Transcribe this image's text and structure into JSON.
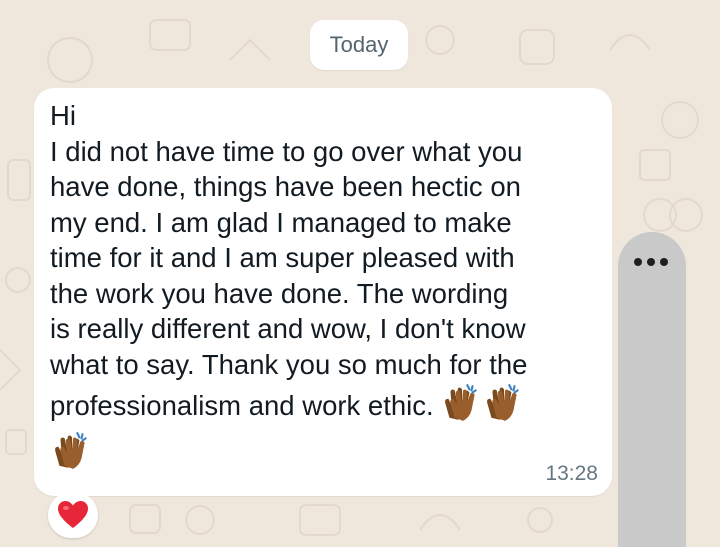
{
  "chat": {
    "date_separator": "Today",
    "message": {
      "text": "Hi\nI did not have time to go over what you\nhave done, things have been hectic on\nmy end. I am glad I managed to make\ntime for it and I am super pleased with\nthe work you have done. The wording\nis really different and wow, I don't know\nwhat to say. Thank you so much for the\nprofessionalism and work ethic.",
      "inline_emojis": [
        "clapping-hands-medium-dark",
        "clapping-hands-medium-dark"
      ],
      "trailing_emojis": [
        "clapping-hands-medium-dark"
      ],
      "time": "13:28",
      "reaction": "red-heart"
    }
  },
  "overlay": {
    "more_icon": "more-dots-icon"
  },
  "colors": {
    "wallpaper": "#efe7dc",
    "bubble": "#ffffff",
    "text": "#111b21",
    "meta": "#667781",
    "clap_skin": "#8d5524",
    "heart": "#e8263a",
    "scroll_handle": "#c9c9c9"
  }
}
